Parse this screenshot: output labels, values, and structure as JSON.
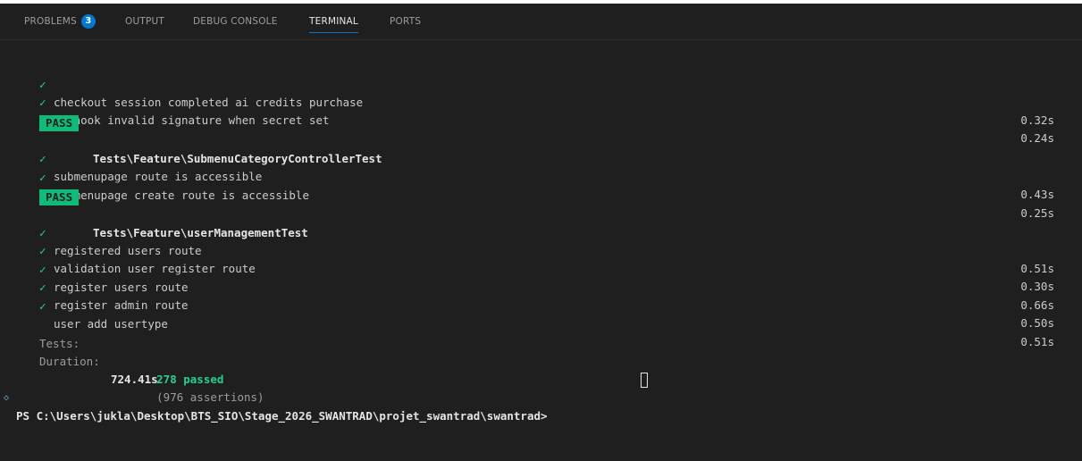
{
  "tabs": [
    {
      "label": "PROBLEMS",
      "badge": "3"
    },
    {
      "label": "OUTPUT"
    },
    {
      "label": "DEBUG CONSOLE"
    },
    {
      "label": "TERMINAL"
    },
    {
      "label": "PORTS"
    }
  ],
  "active_tab": "TERMINAL",
  "terminal": {
    "check_glyph": "✓",
    "pass_label": "PASS",
    "tests_top": [
      {
        "name": "checkout session completed ai credits purchase",
        "time": "0.32s"
      },
      {
        "name": "webhook invalid signature when secret set",
        "time": "0.24s"
      }
    ],
    "suites": [
      {
        "name": "Tests\\Feature\\SubmenuCategoryControllerTest",
        "tests": [
          {
            "name": "submenupage route is accessible",
            "time": "0.43s"
          },
          {
            "name": "submenupage create route is accessible",
            "time": "0.25s"
          }
        ]
      },
      {
        "name": "Tests\\Feature\\userManagementTest",
        "tests": [
          {
            "name": "registered users route",
            "time": "0.51s"
          },
          {
            "name": "validation user register route",
            "time": "0.30s"
          },
          {
            "name": "register users route",
            "time": "0.66s"
          },
          {
            "name": "register admin route",
            "time": "0.50s"
          },
          {
            "name": "user add usertype",
            "time": "0.51s"
          }
        ]
      }
    ],
    "summary": {
      "tests_label": "Tests:",
      "passed": "278 passed",
      "assertions": "(976 assertions)",
      "duration_label": "Duration:",
      "duration": "724.41s"
    },
    "prompt": "PS C:\\Users\\jukla\\Desktop\\BTS_SIO\\Stage_2026_SWANTRAD\\projet_swantrad\\swantrad>"
  },
  "colors": {
    "background": "#1f1f1f",
    "accent": "#0078d4",
    "pass_badge": "#0dbc79",
    "check": "#23d18b"
  }
}
